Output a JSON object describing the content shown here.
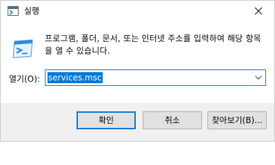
{
  "window": {
    "title": "실행",
    "close_glyph": "✕"
  },
  "main": {
    "description": "프로그램, 폴더, 문서, 또는 인터넷 주소를 입력하여 해당 항목을 열 수 있습니다.",
    "open_label": "열기(O):",
    "open_value": "services.msc",
    "icon": "run-icon"
  },
  "buttons": {
    "ok": "확인",
    "cancel": "취소",
    "browse": "찾아보기(B)..."
  },
  "colors": {
    "accent": "#0078d7",
    "footer_bg": "#f0f0f0",
    "button_bg": "#e1e1e1"
  }
}
